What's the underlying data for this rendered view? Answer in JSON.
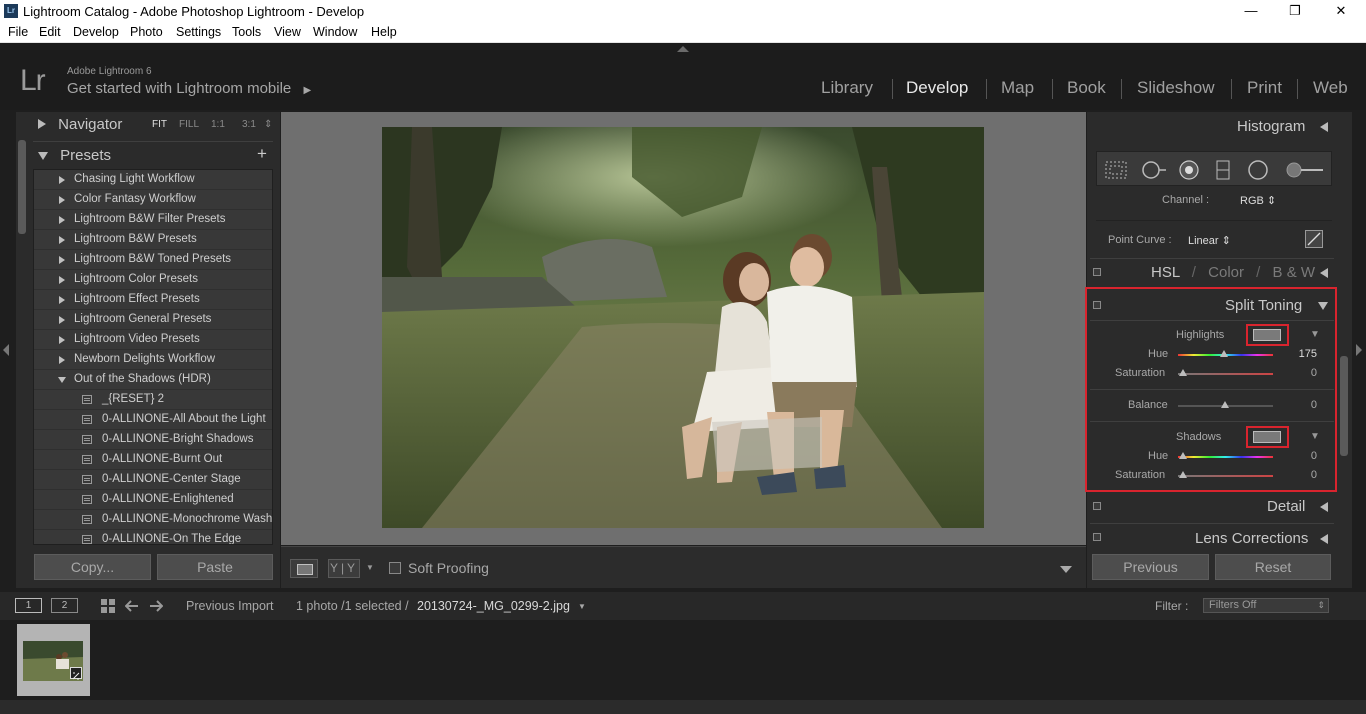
{
  "window": {
    "title": "Lightroom Catalog - Adobe Photoshop Lightroom - Develop",
    "app_icon": "Lr",
    "controls": {
      "minimize": "—",
      "restore": "❐",
      "close": "✕"
    }
  },
  "menu": [
    "File",
    "Edit",
    "Develop",
    "Photo",
    "Settings",
    "Tools",
    "View",
    "Window",
    "Help"
  ],
  "identity": {
    "logo": "Lr",
    "version": "Adobe Lightroom 6",
    "mobile": "Get started with Lightroom mobile",
    "mobile_arrow": "▶"
  },
  "modules": [
    {
      "label": "Library"
    },
    {
      "label": "Develop"
    },
    {
      "label": "Map"
    },
    {
      "label": "Book"
    },
    {
      "label": "Slideshow"
    },
    {
      "label": "Print"
    },
    {
      "label": "Web"
    }
  ],
  "active_module": "Develop",
  "navigator": {
    "title": "Navigator",
    "zoom_options": [
      "FIT",
      "FILL",
      "1:1",
      "3:1"
    ],
    "zoom_menu_arrow": "⇕"
  },
  "presets": {
    "title": "Presets",
    "add": "+",
    "folders": [
      "Chasing Light Workflow",
      "Color Fantasy Workflow",
      "Lightroom B&W Filter Presets",
      "Lightroom B&W Presets",
      "Lightroom B&W Toned Presets",
      "Lightroom Color Presets",
      "Lightroom Effect Presets",
      "Lightroom General Presets",
      "Lightroom Video Presets",
      "Newborn Delights Workflow"
    ],
    "open_folder": "Out of the Shadows (HDR)",
    "items": [
      "_{RESET} 2",
      "0-ALLINONE-All About the Light",
      "0-ALLINONE-Bright Shadows",
      "0-ALLINONE-Burnt Out",
      "0-ALLINONE-Center Stage",
      "0-ALLINONE-Enlightened",
      "0-ALLINONE-Monochrome Wash",
      "0-ALLINONE-On The Edge"
    ]
  },
  "left_buttons": {
    "copy": "Copy...",
    "paste": "Paste"
  },
  "toolbar": {
    "yy": "Y|Y",
    "soft_proofing": "Soft Proofing"
  },
  "right_panel": {
    "histogram": "Histogram",
    "tone_curve": {
      "channel_label": "Channel :",
      "channel_value": "RGB ⇕",
      "point_curve_label": "Point Curve :",
      "point_curve_value": "Linear ⇕"
    },
    "hsl": {
      "hsl": "HSL",
      "sep": "/",
      "color": "Color",
      "bw": "B & W"
    },
    "split_toning": {
      "title": "Split Toning",
      "highlights_label": "Highlights",
      "highlights_hue_label": "Hue",
      "highlights_hue_value": "175",
      "highlights_hue": 175,
      "highlights_saturation_label": "Saturation",
      "highlights_saturation_value": "0",
      "balance_label": "Balance",
      "balance_value": "0",
      "shadows_label": "Shadows",
      "shadows_hue_label": "Hue",
      "shadows_hue_value": "0",
      "shadows_saturation_label": "Saturation",
      "shadows_saturation_value": "0"
    },
    "detail": "Detail",
    "lens_corrections": "Lens Corrections",
    "previous": "Previous",
    "reset": "Reset"
  },
  "filmstrip": {
    "monitor1": "1",
    "monitor2": "2",
    "source": "Previous Import",
    "count": "1 photo /1 selected /",
    "filename": "20130724-_MG_0299-2.jpg",
    "filename_arrow": "▼",
    "filter_label": "Filter :",
    "filter_value": "Filters Off"
  }
}
